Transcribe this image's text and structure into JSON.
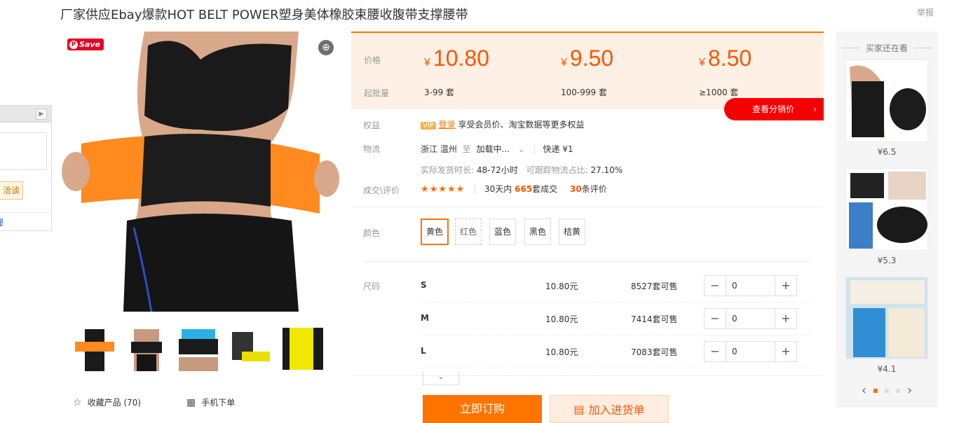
{
  "product": {
    "title": "厂家供应Ebay爆款HOT BELT POWER塑身美体橡胶束腰收腹带支撑腰带",
    "report": "举报"
  },
  "chat_widget": {
    "consult_label": "洽谈",
    "link_label": "理"
  },
  "gallery": {
    "save_label": "Save",
    "thumbnail_count": 5
  },
  "actions": {
    "favorite_label": "收藏产品 (70)",
    "mobile_order_label": "手机下单"
  },
  "pricing": {
    "price_label": "价格",
    "moq_label": "起批量",
    "currency": "¥",
    "tiers": [
      {
        "price": "10.80",
        "range": "3-99 套"
      },
      {
        "price": "9.50",
        "range": "100-999 套"
      },
      {
        "price": "8.50",
        "range": "≥1000 套"
      }
    ],
    "distributor_button": "查看分销价",
    "chevron": "›"
  },
  "benefits": {
    "label": "权益",
    "vip": "VIP",
    "login": "登录",
    "text": "享受会员价、淘宝数据等更多权益"
  },
  "logistics": {
    "label": "物流",
    "from": "浙江 温州",
    "to": "至",
    "dest": "加载中...",
    "express": "快递 ¥1",
    "ship_time_label": "实际发货时长:",
    "ship_time": "48-72小时",
    "track_label": "可跟踪物流占比:",
    "track_rate": "27.10%"
  },
  "reviews": {
    "label": "成交\\评价",
    "stars": "★★★★★",
    "rating_fraction": 0.9,
    "days_label": "30天内",
    "sold": "665",
    "sold_unit": "套成交",
    "review_count": "30",
    "review_unit": "条评价"
  },
  "colors": {
    "label": "颜色",
    "options": [
      "黄色",
      "红色",
      "蓝色",
      "黑色",
      "桔黄"
    ],
    "selected": "黄色"
  },
  "sizes": {
    "label": "尺码",
    "rows": [
      {
        "name": "S",
        "price": "10.80元",
        "stock": "8527套可售",
        "qty": "0"
      },
      {
        "name": "M",
        "price": "10.80元",
        "stock": "7414套可售",
        "qty": "0"
      },
      {
        "name": "L",
        "price": "10.80元",
        "stock": "7083套可售",
        "qty": "0"
      }
    ],
    "minus": "−",
    "plus": "+"
  },
  "buttons": {
    "buy_now": "立即订购",
    "add_cart": "加入进货单"
  },
  "sidebar": {
    "title": "买家还在看",
    "items": [
      {
        "price": "¥6.5"
      },
      {
        "price": "¥5.3"
      },
      {
        "price": "¥4.1"
      }
    ],
    "prev": "‹",
    "next": "›"
  },
  "colors_theme": {
    "accent": "#ff7300",
    "price": "#ff5500",
    "red_button": "#f40000"
  }
}
